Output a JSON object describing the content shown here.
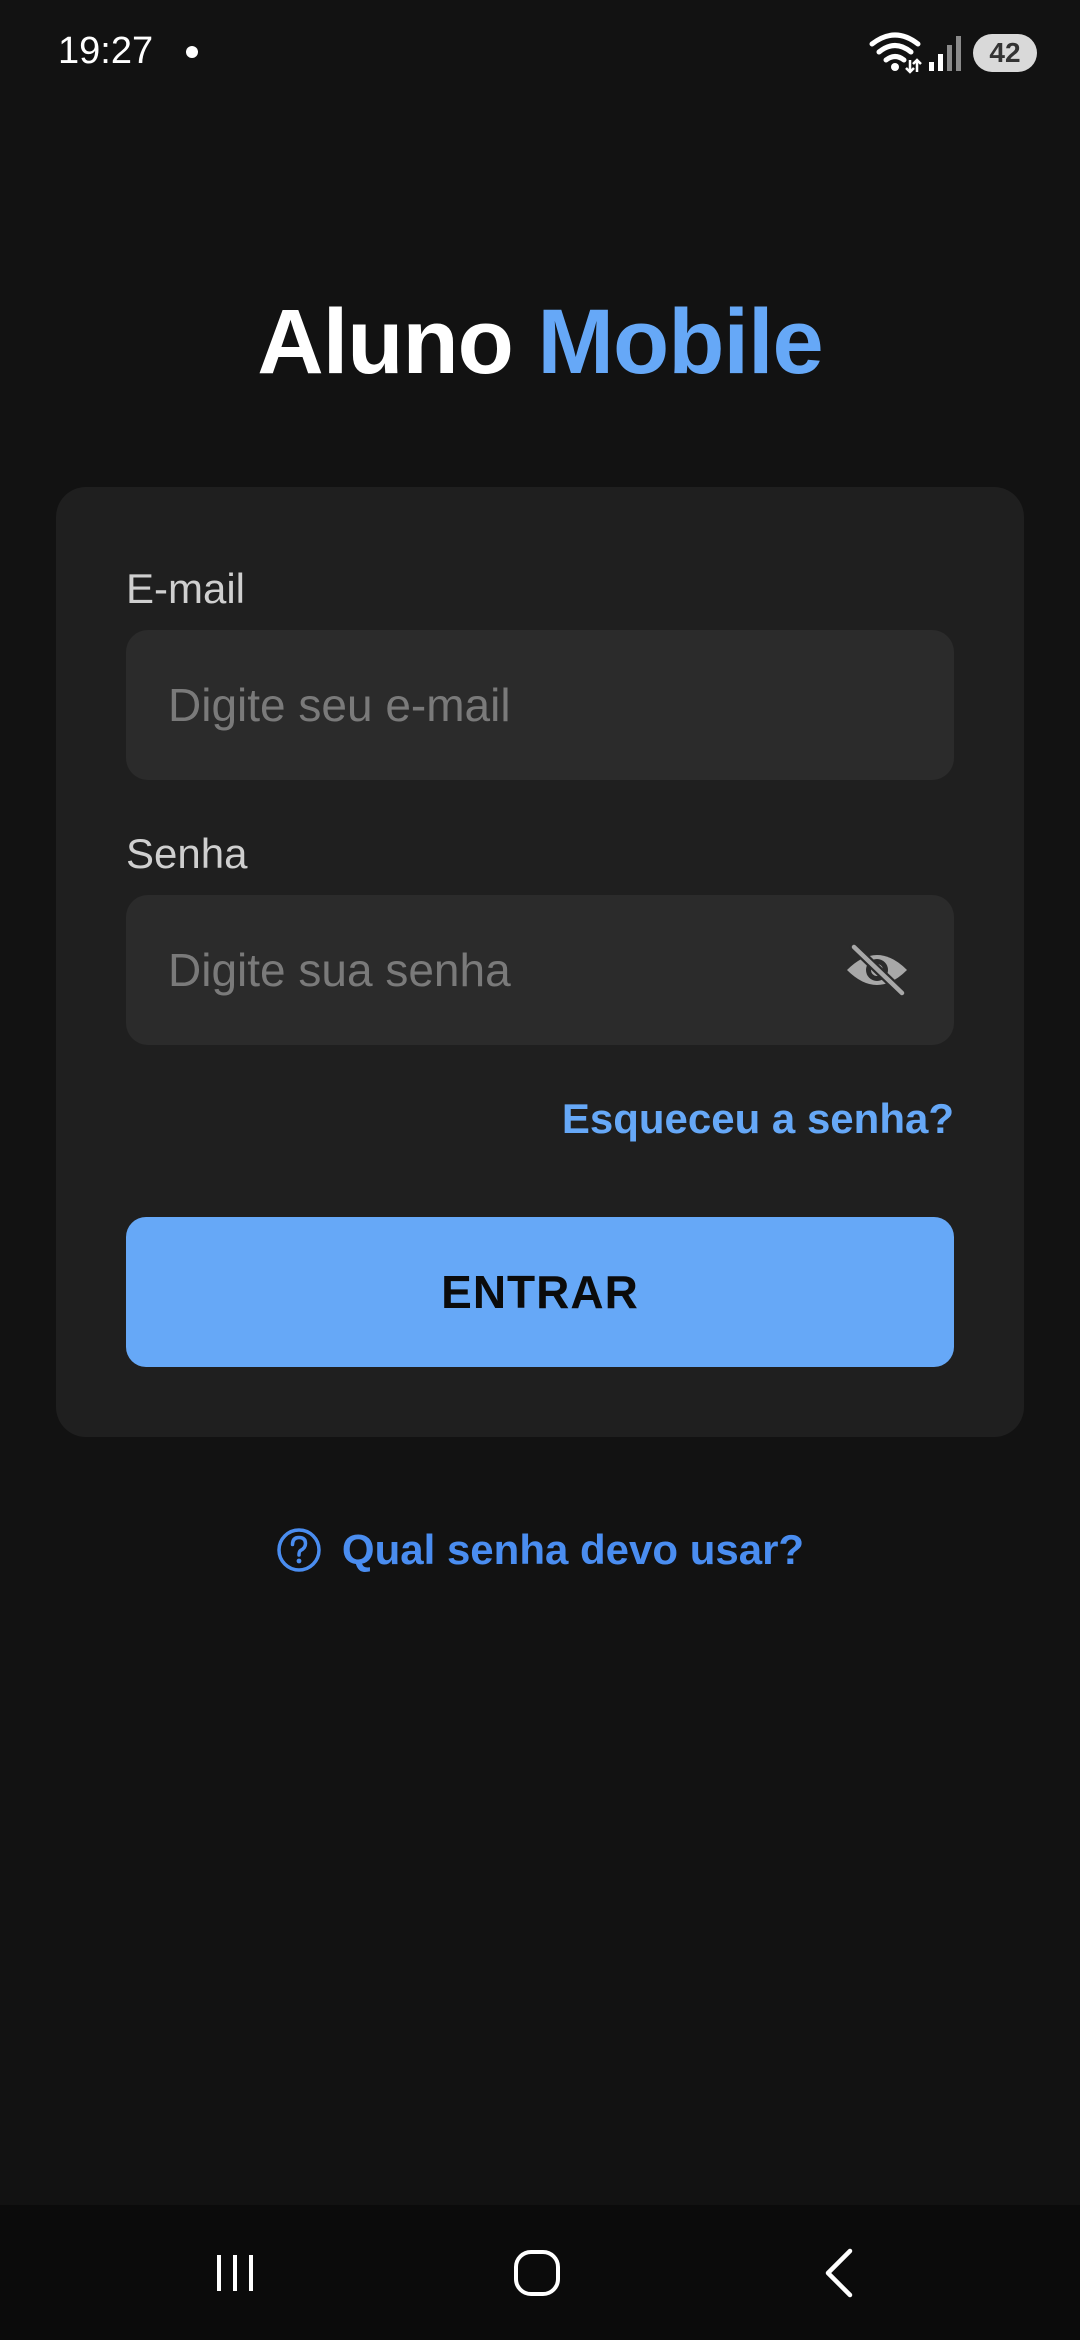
{
  "status_bar": {
    "time": "19:27",
    "battery": "42"
  },
  "header": {
    "title_part1": "Aluno",
    "title_part2": "Mobile"
  },
  "form": {
    "email_label": "E-mail",
    "email_placeholder": "Digite seu e-mail",
    "email_value": "",
    "password_label": "Senha",
    "password_placeholder": "Digite sua senha",
    "password_value": "",
    "password_toggle_icon": "eye-off-icon",
    "forgot_link": "Esqueceu a senha?",
    "submit_label": "ENTRAR"
  },
  "help": {
    "icon": "help-circle-icon",
    "text": "Qual senha devo usar?"
  },
  "nav_bar": {
    "icons": [
      "recent-apps-icon",
      "home-icon",
      "back-icon"
    ]
  },
  "colors": {
    "background": "#121212",
    "card": "#1f1f1f",
    "input": "#2b2b2b",
    "accent": "#66a8f7",
    "help_link": "#4a8df0"
  }
}
